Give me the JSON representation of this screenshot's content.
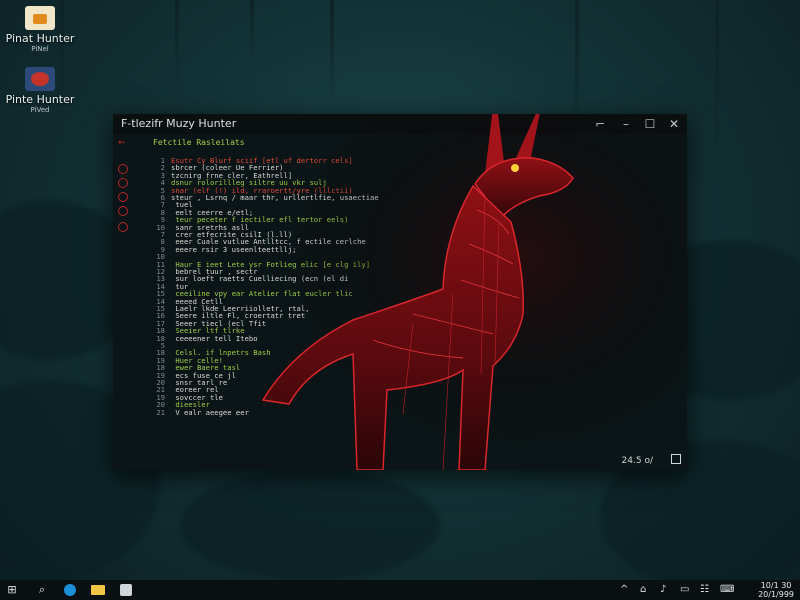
{
  "desktop": {
    "icons": [
      {
        "label": "Pinat Hunter",
        "sub": "PiNel"
      },
      {
        "label": "Pinte Hunter",
        "sub": "PiVed"
      }
    ]
  },
  "window": {
    "title": "F-tlezifr Muzy Hunter",
    "controls": {
      "minimize": "–",
      "maximize": "☐",
      "close": "✕",
      "snap": "⌐"
    },
    "code_header": "Fetctile Rasleilats",
    "lines": [
      {
        "n": "1",
        "t": "Esutr Cy Blurf sciif [etl uf dertorr cels]"
      },
      {
        "n": "2",
        "t": "sbrcer  (coleer Ue Ferrier)"
      },
      {
        "n": "3",
        "t": "tzcnirg  frne cler, Eathrell]"
      },
      {
        "n": "4",
        "t": "dsnur  rolorillleg  siltre uu vkr sulj"
      },
      {
        "n": "5",
        "t": "snar  (elf  (!)  ild, rraroertt/yre  (lllctii)"
      },
      {
        "n": "6",
        "t": "steur , Lsrnq / maar thr, urllertlfie, usaectiae"
      },
      {
        "n": "7",
        "t": "  tuel"
      },
      {
        "n": "8",
        "t": "  eelt  ceerre  e/etl;"
      },
      {
        "n": "9",
        "t": "  teur  peceter f  iectiler  efl  tertor eels)"
      },
      {
        "n": "10",
        "t": "  sanr  sretrhs  asll"
      },
      {
        "n": "7",
        "t": "  crer  etfecrite  csilI  (l.ll)"
      },
      {
        "n": "8",
        "t": "  eeer  Cuale  vutlue  Antlltcc,  f  ectile  cerlche"
      },
      {
        "n": "9",
        "t": "  eeere  rsir  3  useenlteettllj;"
      },
      {
        "n": "10",
        "t": ""
      },
      {
        "n": "11",
        "t": "  Haur  E  ieet  Lete  ysr  Fotlieg  elic  [e  clg  ily]"
      },
      {
        "n": "12",
        "t": "    bebrel  tuur  ,  sectr"
      },
      {
        "n": "13",
        "t": "      sur  loeft  raetts  Cuelliecing  (ecn  (el  di"
      },
      {
        "n": "14",
        "t": "      tur"
      },
      {
        "n": "15",
        "t": "      ceeiline  vpy  ear  Atelier  flat  eucler  tlic"
      },
      {
        "n": "14",
        "t": "      eeeed  Cetll"
      },
      {
        "n": "15",
        "t": "      Laelr  lkde  Leerriiolletr,  rtal,"
      },
      {
        "n": "16",
        "t": "      Seere  iltle  Fl,  croertatr  tret"
      },
      {
        "n": "17",
        "t": "      Seeer  tiecl  (ecl  Tfit"
      },
      {
        "n": "18",
        "t": "      Seeier  ltf  tlrke"
      },
      {
        "n": "18",
        "t": "      ceeeener  tell  Itebo"
      },
      {
        "n": "5",
        "t": ""
      },
      {
        "n": "18",
        "t": "  Celsl.  if  lnpetrs  Bash"
      },
      {
        "n": "19",
        "t": "  Huer  celle!"
      },
      {
        "n": "18",
        "t": "    ewer  Baere  tasl"
      },
      {
        "n": "19",
        "t": "    ecs  fuse  ce  jl"
      },
      {
        "n": "20",
        "t": "    snsr  tarl  re"
      },
      {
        "n": "21",
        "t": "    eoreer  rel"
      },
      {
        "n": "19",
        "t": "    sovccer  tle"
      },
      {
        "n": "20",
        "t": "    dieesler"
      },
      {
        "n": "21",
        "t": "  V  ealr  aeegee  eer"
      }
    ],
    "status_text": "24.5 o/"
  },
  "taskbar": {
    "start": "⊞",
    "search": "⌕",
    "clock_time": "10/1 30",
    "clock_date": "20/1/999"
  },
  "colors": {
    "accent_red": "#c81e24",
    "code_green": "#9ccf45",
    "bg_teal": "#1f4a4f"
  }
}
